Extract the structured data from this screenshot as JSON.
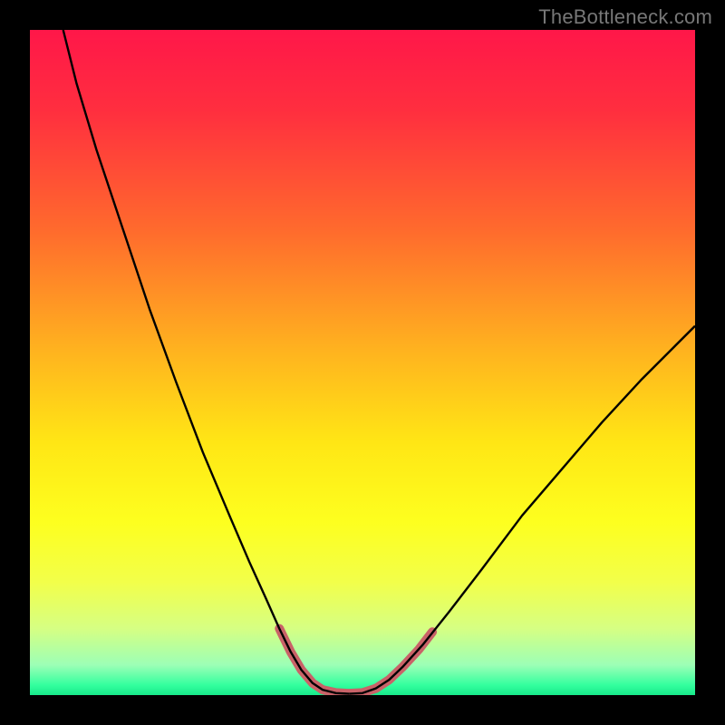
{
  "watermark": "TheBottleneck.com",
  "chart_data": {
    "type": "line",
    "title": "",
    "xlabel": "",
    "ylabel": "",
    "xlim": [
      0,
      100
    ],
    "ylim": [
      0,
      100
    ],
    "gradient_stops": [
      {
        "offset": 0.0,
        "color": "#ff1749"
      },
      {
        "offset": 0.12,
        "color": "#ff2e3f"
      },
      {
        "offset": 0.3,
        "color": "#ff6a2d"
      },
      {
        "offset": 0.48,
        "color": "#ffb21f"
      },
      {
        "offset": 0.62,
        "color": "#ffe615"
      },
      {
        "offset": 0.74,
        "color": "#fdff1f"
      },
      {
        "offset": 0.83,
        "color": "#f2ff4a"
      },
      {
        "offset": 0.9,
        "color": "#d6ff83"
      },
      {
        "offset": 0.955,
        "color": "#9cffb6"
      },
      {
        "offset": 0.985,
        "color": "#33ff9e"
      },
      {
        "offset": 1.0,
        "color": "#17e98a"
      }
    ],
    "series": [
      {
        "name": "left-branch",
        "stroke": "#000000",
        "width": 2.4,
        "points": [
          {
            "x": 5.0,
            "y": 100.0
          },
          {
            "x": 7.0,
            "y": 92.0
          },
          {
            "x": 10.0,
            "y": 82.0
          },
          {
            "x": 14.0,
            "y": 70.0
          },
          {
            "x": 18.0,
            "y": 58.0
          },
          {
            "x": 22.0,
            "y": 47.0
          },
          {
            "x": 26.0,
            "y": 36.5
          },
          {
            "x": 30.0,
            "y": 27.0
          },
          {
            "x": 33.0,
            "y": 20.0
          },
          {
            "x": 35.5,
            "y": 14.5
          },
          {
            "x": 37.5,
            "y": 10.0
          },
          {
            "x": 39.2,
            "y": 6.5
          },
          {
            "x": 40.8,
            "y": 3.8
          },
          {
            "x": 42.5,
            "y": 1.8
          },
          {
            "x": 44.0,
            "y": 0.8
          },
          {
            "x": 46.0,
            "y": 0.3
          },
          {
            "x": 48.0,
            "y": 0.2
          }
        ]
      },
      {
        "name": "right-branch",
        "stroke": "#000000",
        "width": 2.4,
        "points": [
          {
            "x": 48.0,
            "y": 0.2
          },
          {
            "x": 50.0,
            "y": 0.3
          },
          {
            "x": 52.0,
            "y": 1.0
          },
          {
            "x": 54.0,
            "y": 2.3
          },
          {
            "x": 56.0,
            "y": 4.2
          },
          {
            "x": 59.0,
            "y": 7.5
          },
          {
            "x": 63.0,
            "y": 12.5
          },
          {
            "x": 68.0,
            "y": 19.0
          },
          {
            "x": 74.0,
            "y": 27.0
          },
          {
            "x": 80.0,
            "y": 34.0
          },
          {
            "x": 86.0,
            "y": 41.0
          },
          {
            "x": 92.0,
            "y": 47.5
          },
          {
            "x": 97.0,
            "y": 52.5
          },
          {
            "x": 100.0,
            "y": 55.5
          }
        ]
      },
      {
        "name": "highlight-left",
        "stroke": "#c96268",
        "width": 10,
        "linecap": "round",
        "points": [
          {
            "x": 37.5,
            "y": 10.0
          },
          {
            "x": 39.2,
            "y": 6.5
          },
          {
            "x": 40.8,
            "y": 3.8
          },
          {
            "x": 42.5,
            "y": 1.8
          },
          {
            "x": 44.0,
            "y": 0.8
          }
        ]
      },
      {
        "name": "highlight-bottom",
        "stroke": "#c96268",
        "width": 10,
        "linecap": "round",
        "points": [
          {
            "x": 44.0,
            "y": 0.8
          },
          {
            "x": 46.0,
            "y": 0.35
          },
          {
            "x": 48.0,
            "y": 0.25
          },
          {
            "x": 50.0,
            "y": 0.35
          },
          {
            "x": 52.0,
            "y": 1.0
          }
        ]
      },
      {
        "name": "highlight-right",
        "stroke": "#c96268",
        "width": 10,
        "linecap": "round",
        "points": [
          {
            "x": 52.0,
            "y": 1.0
          },
          {
            "x": 54.0,
            "y": 2.3
          },
          {
            "x": 56.0,
            "y": 4.2
          },
          {
            "x": 58.5,
            "y": 6.9
          },
          {
            "x": 60.5,
            "y": 9.5
          }
        ]
      }
    ]
  }
}
